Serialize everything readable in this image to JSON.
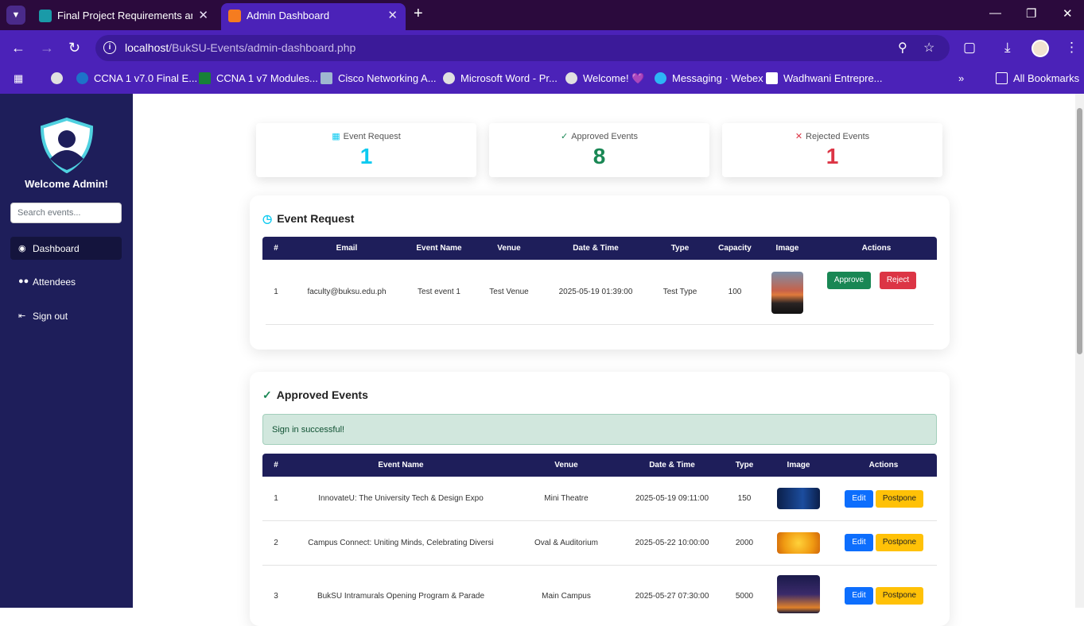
{
  "browser": {
    "tabs": [
      {
        "label": "Final Project Requirements and",
        "active": false
      },
      {
        "label": "Admin Dashboard",
        "active": true
      }
    ],
    "url_host": "localhost",
    "url_path": "/BukSU-Events/admin-dashboard.php",
    "bookmarks": [
      "CCNA 1 v7.0 Final E...",
      "CCNA 1 v7 Modules...",
      "Cisco Networking A...",
      "Microsoft Word - Pr...",
      "Welcome! 💜",
      "Messaging · Webex",
      "Wadhwani Entrepre..."
    ],
    "all_bookmarks": "All Bookmarks"
  },
  "sidebar": {
    "welcome": "Welcome Admin!",
    "search_placeholder": "Search events...",
    "items": [
      {
        "label": "Dashboard",
        "icon": "dashboard-icon",
        "active": true
      },
      {
        "label": "Attendees",
        "icon": "users-icon",
        "active": false
      },
      {
        "label": "Sign out",
        "icon": "sign-out-icon",
        "active": false
      }
    ]
  },
  "stats": [
    {
      "label": "Event Request",
      "value": "1",
      "icon": "calendar-icon",
      "color": "#0dcaf0"
    },
    {
      "label": "Approved Events",
      "value": "8",
      "icon": "check-icon",
      "color": "#198754"
    },
    {
      "label": "Rejected Events",
      "value": "1",
      "icon": "x-icon",
      "color": "#dc3545"
    }
  ],
  "event_request": {
    "title": "Event Request",
    "columns": [
      "#",
      "Email",
      "Event Name",
      "Venue",
      "Date & Time",
      "Type",
      "Capacity",
      "Image",
      "Actions"
    ],
    "rows": [
      {
        "num": "1",
        "email": "faculty@buksu.edu.ph",
        "name": "Test event 1",
        "venue": "Test Venue",
        "datetime": "2025-05-19 01:39:00",
        "type": "Test Type",
        "capacity": "100"
      }
    ],
    "approve_label": "Approve",
    "reject_label": "Reject"
  },
  "approved_events": {
    "title": "Approved Events",
    "alert": "Sign in successful!",
    "columns": [
      "#",
      "Event Name",
      "Venue",
      "Date & Time",
      "Type",
      "Image",
      "Actions"
    ],
    "rows": [
      {
        "num": "1",
        "name": "InnovateU: The University Tech & Design Expo",
        "venue": "Mini Theatre",
        "datetime": "2025-05-19 09:11:00",
        "type": "150"
      },
      {
        "num": "2",
        "name": "Campus Connect: Uniting Minds, Celebrating Diversi",
        "venue": "Oval & Auditorium",
        "datetime": "2025-05-22 10:00:00",
        "type": "2000"
      },
      {
        "num": "3",
        "name": "BukSU Intramurals Opening Program & Parade",
        "venue": "Main Campus",
        "datetime": "2025-05-27 07:30:00",
        "type": "5000"
      }
    ],
    "edit_label": "Edit",
    "postpone_label": "Postpone"
  }
}
